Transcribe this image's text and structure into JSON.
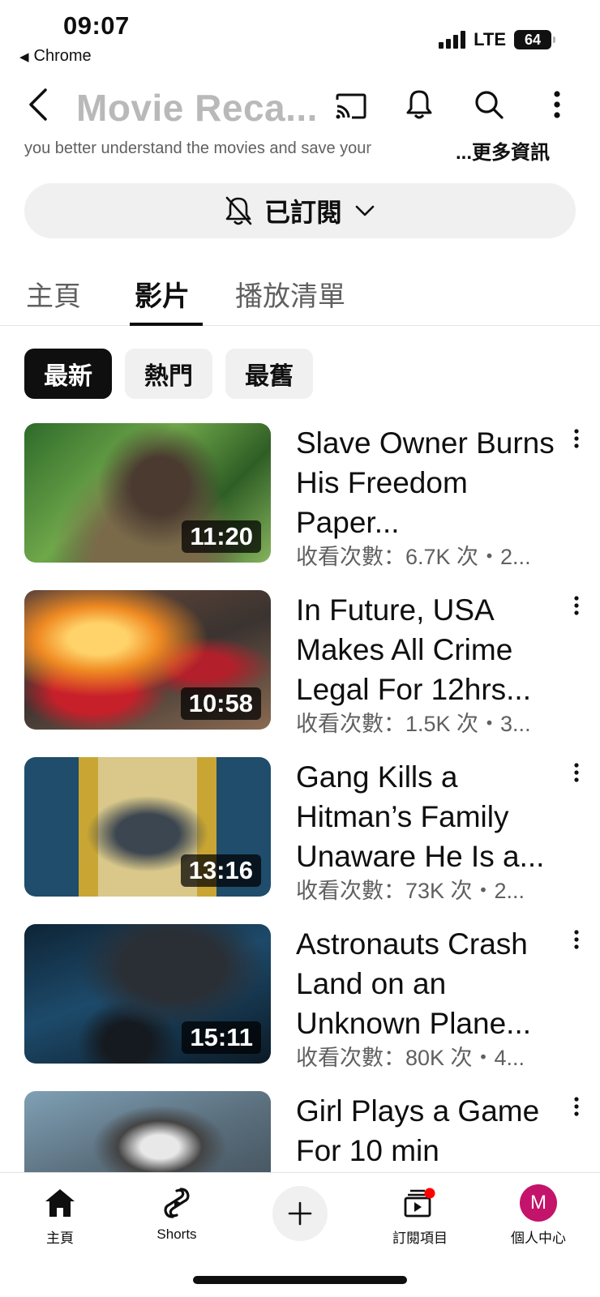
{
  "status_bar": {
    "time": "09:07",
    "back_app": "Chrome",
    "network": "LTE",
    "battery": "64"
  },
  "header": {
    "title": "Movie Reca...",
    "description": "you better understand the movies and save your",
    "more_info": "...更多資訊",
    "icons": [
      "back-icon",
      "cast-icon",
      "bell-icon",
      "search-icon",
      "more-vert-icon"
    ]
  },
  "subscribe": {
    "label": "已訂閱"
  },
  "tabs": [
    {
      "label": "主頁"
    },
    {
      "label": "影片"
    },
    {
      "label": "播放清單"
    }
  ],
  "chips": [
    {
      "label": "最新"
    },
    {
      "label": "熱門"
    },
    {
      "label": "最舊"
    }
  ],
  "videos": [
    {
      "title": "Slave Owner Burns His Freedom Paper...",
      "duration": "11:20",
      "meta": "收看次數：6.7K 次・2..."
    },
    {
      "title": "In Future, USA Makes All Crime Legal For 12hrs...",
      "duration": "10:58",
      "meta": "收看次數：1.5K 次・3..."
    },
    {
      "title": "Gang Kills a Hitman’s Family Unaware He Is a...",
      "duration": "13:16",
      "meta": "收看次數：73K 次・2..."
    },
    {
      "title": "Astronauts Crash Land on an Unknown Plane...",
      "duration": "15:11",
      "meta": "收看次數：80K 次・4..."
    },
    {
      "title": "Girl Plays a Game For 10 min",
      "duration": "",
      "meta": ""
    }
  ],
  "bottom_nav": {
    "home": "主頁",
    "shorts": "Shorts",
    "subscriptions": "訂閱項目",
    "profile": "個人中心",
    "avatar_letter": "M"
  },
  "colors": {
    "accent_red": "#ff0000",
    "avatar": "#c4136a",
    "chip_selected": "#0f0f0f",
    "chip_default": "#f0f0f0"
  }
}
